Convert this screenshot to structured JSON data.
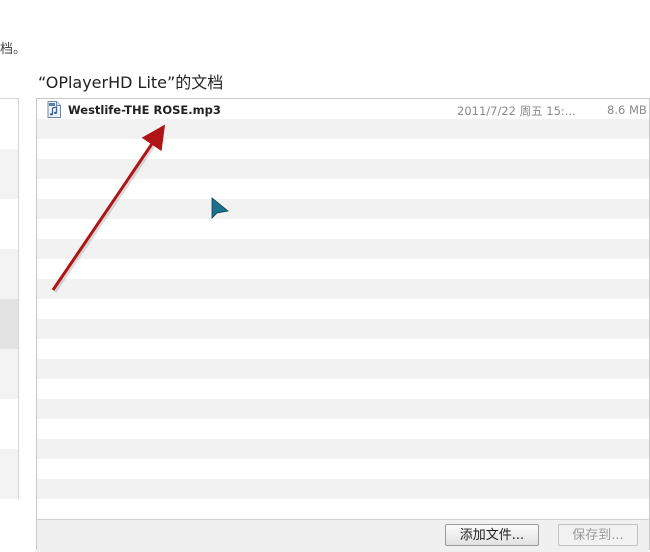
{
  "header": {
    "truncated_text": "档。",
    "section_title": "“OPlayerHD  Lite”的文档"
  },
  "documents": {
    "files": [
      {
        "name": "Westlife-THE ROSE.mp3",
        "date": "2011/7/22 周五 15:...",
        "size": "8.6 MB",
        "icon": "audio-file-icon"
      }
    ]
  },
  "buttons": {
    "add_file": "添加文件...",
    "save_to": "保存到..."
  },
  "annotation": {
    "arrow_color": "#b01515"
  }
}
